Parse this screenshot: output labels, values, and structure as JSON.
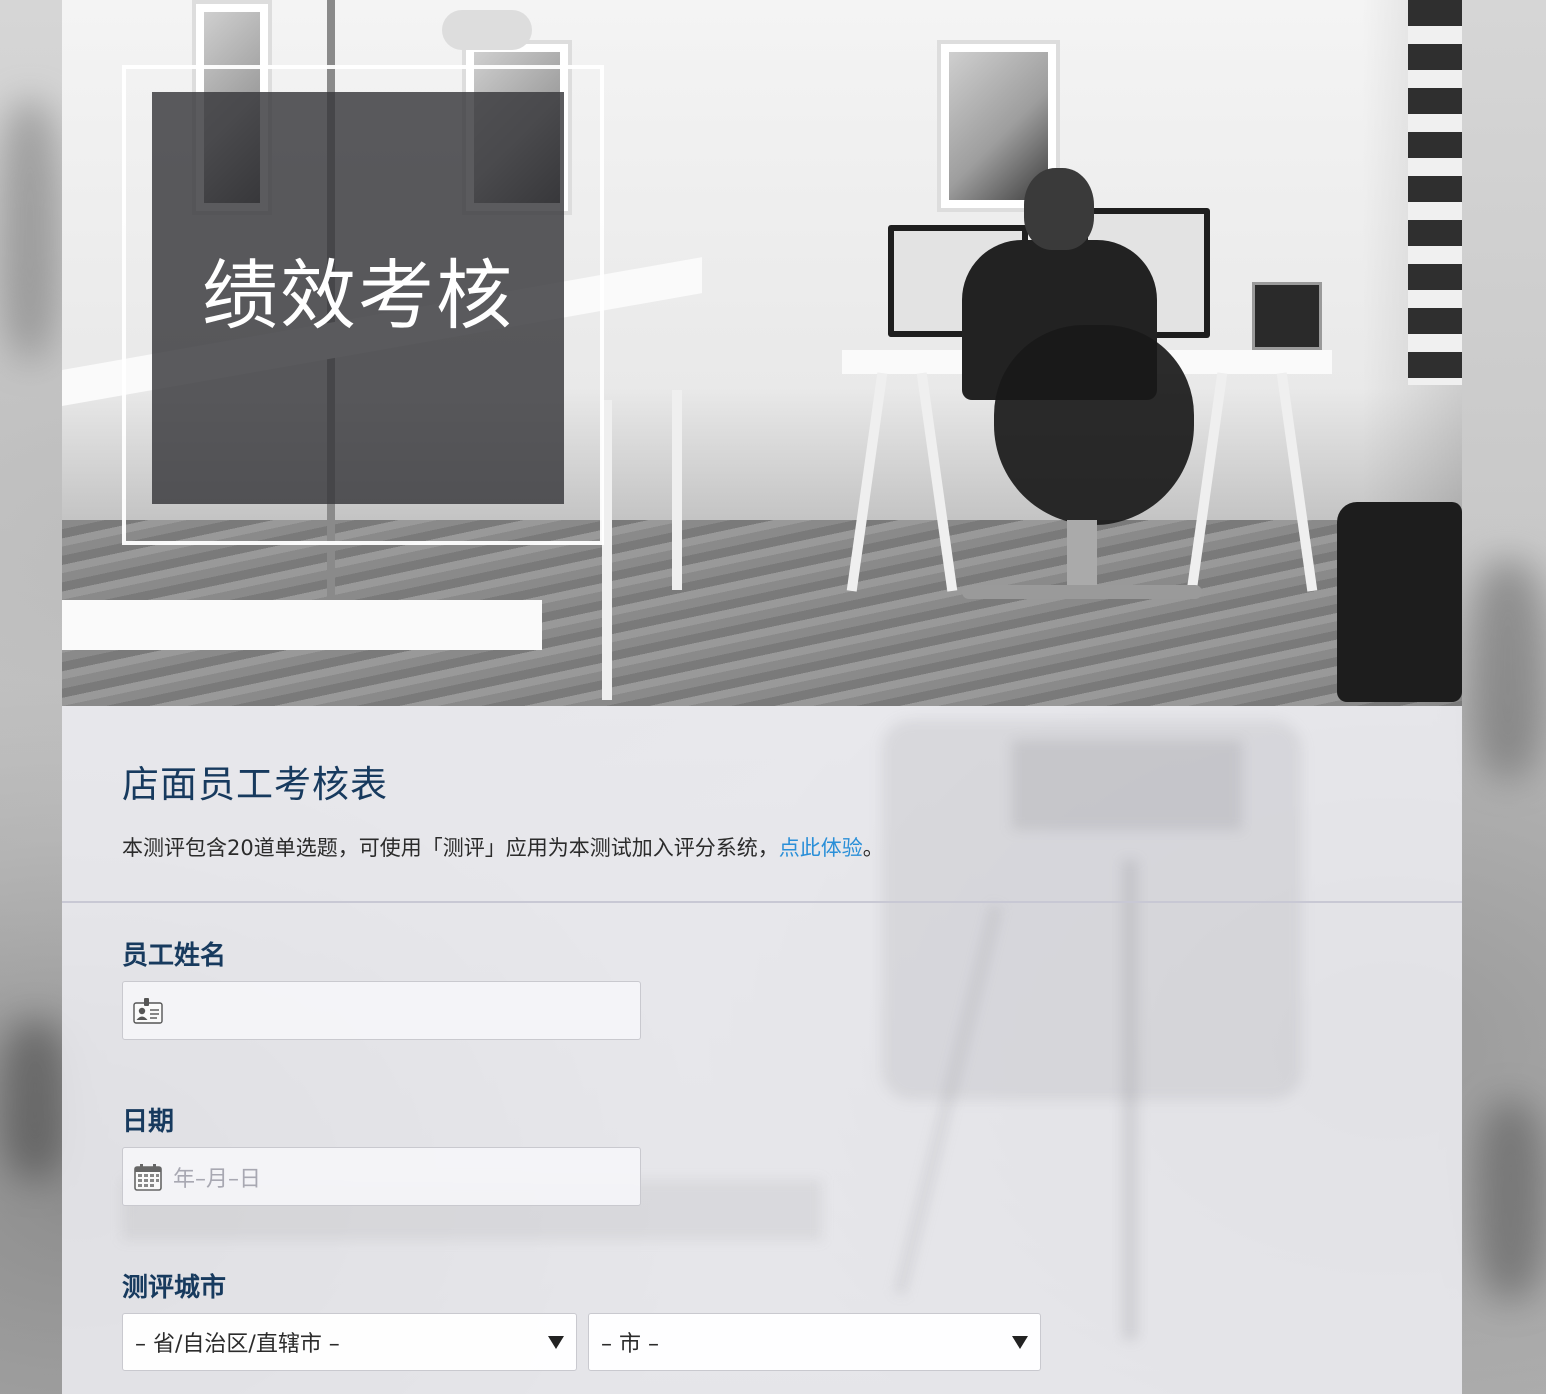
{
  "hero": {
    "title": "绩效考核"
  },
  "form": {
    "title": "店面员工考核表",
    "description_prefix": "本测评包含20道单选题，可使用「测评」应用为本测试加入评分系统，",
    "description_link": "点此体验",
    "description_suffix": "。",
    "link_color": "#2a8fd8",
    "title_color": "#173a5e"
  },
  "fields": {
    "employee_name": {
      "label": "员工姓名",
      "icon": "id-card-icon",
      "value": ""
    },
    "date": {
      "label": "日期",
      "icon": "calendar-icon",
      "placeholder": "年–月–日"
    },
    "city": {
      "label": "测评城市",
      "province_selected": "– 省/自治区/直辖市 –",
      "city_selected": "– 市 –"
    }
  }
}
